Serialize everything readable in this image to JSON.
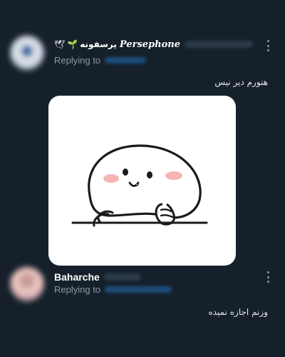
{
  "tweets": [
    {
      "display_name": "Persephone",
      "display_name_fa": "پرسفونه",
      "emoji_sprout": "🌱",
      "emoji_dove": "🕊",
      "reply_prefix": "Replying to",
      "text": "هنورم دیر نیس",
      "media_icon": "cute-blob-sticker"
    },
    {
      "display_name": "Baharche",
      "reply_prefix": "Replying to",
      "text": "وزنم اجازه نمیده"
    }
  ],
  "colors": {
    "background": "#15202b",
    "text": "#e7e9ea",
    "muted": "#8b98a5",
    "link": "#1d9bf0"
  }
}
